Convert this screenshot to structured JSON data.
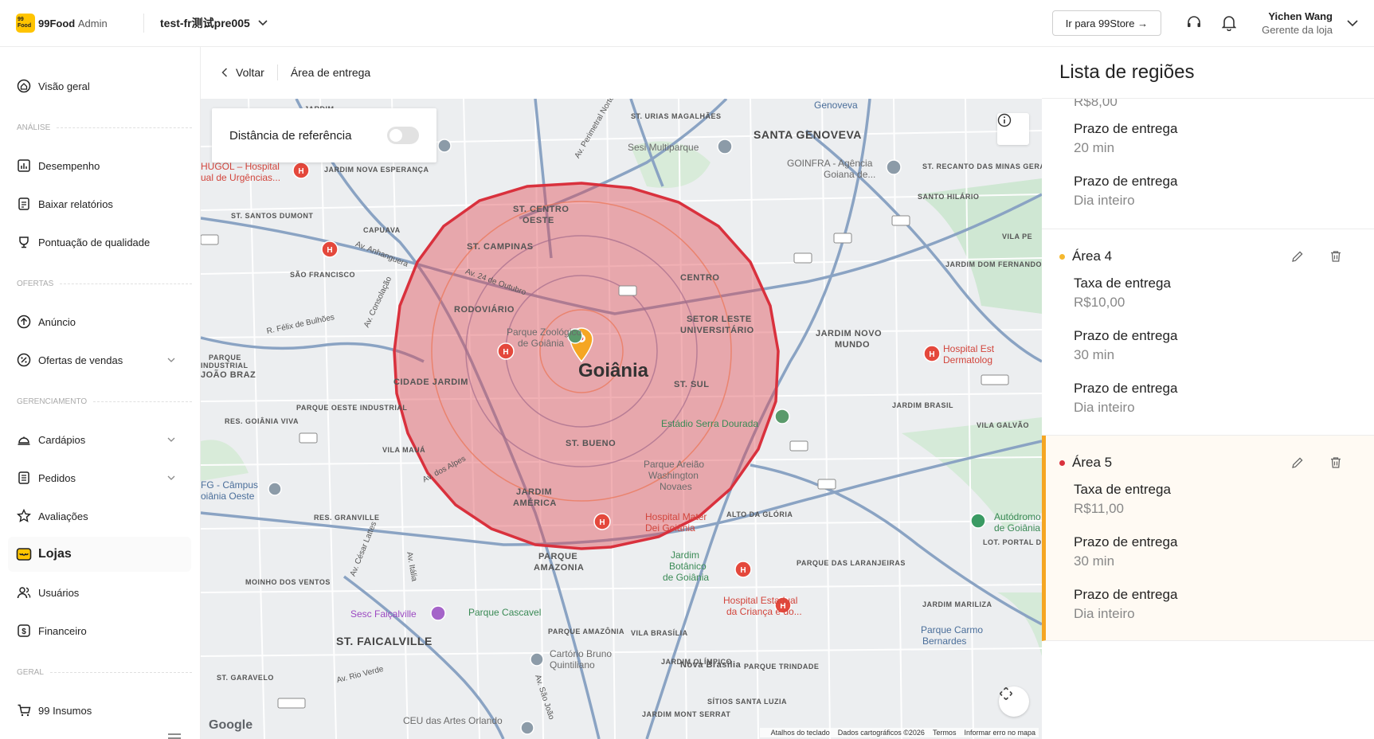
{
  "header": {
    "brand_logo_text": "99 Food",
    "brand_name": "99Food",
    "brand_suffix": "Admin",
    "store_name": "test-fr测试pre005",
    "store_button": "Ir para 99Store →",
    "user_name": "Yichen Wang",
    "user_role": "Gerente da loja"
  },
  "sidebar": {
    "items": [
      {
        "label": "Visão geral",
        "icon": "home-icon"
      },
      {
        "label": "Desempenho",
        "icon": "chart-icon"
      },
      {
        "label": "Baixar relatórios",
        "icon": "report-icon"
      },
      {
        "label": "Pontuação de qualidade",
        "icon": "trophy-icon"
      },
      {
        "label": "Anúncio",
        "icon": "arrow-up-circle-icon"
      },
      {
        "label": "Ofertas de vendas",
        "icon": "discount-icon"
      },
      {
        "label": "Cardápios",
        "icon": "cloche-icon"
      },
      {
        "label": "Pedidos",
        "icon": "orders-icon"
      },
      {
        "label": "Avaliações",
        "icon": "star-icon"
      },
      {
        "label": "Lojas",
        "icon": "store-icon"
      },
      {
        "label": "Usuários",
        "icon": "users-icon"
      },
      {
        "label": "Financeiro",
        "icon": "dollar-icon"
      },
      {
        "label": "99 Insumos",
        "icon": "cart-icon"
      }
    ],
    "sections": [
      "ANÁLISE",
      "OFERTAS",
      "GERENCIAMENTO",
      "GERAL"
    ]
  },
  "breadcrumb": {
    "back_label": "Voltar",
    "title": "Área de entrega"
  },
  "map": {
    "reference_label": "Distância de referência",
    "reference_enabled": false,
    "zone_color": "#d9313d",
    "zone_fill": "#e8787f",
    "labels": {
      "city": "Goiânia",
      "genoveva": "Genoveva",
      "santa_genoveva": "SANTA GENOVEVA",
      "st_centro_oeste_1": "ST. CENTRO",
      "st_centro_oeste_2": "OESTE",
      "st_campinas": "ST. CAMPINAS",
      "centro": "CENTRO",
      "rodoviario": "RODOVIÁRIO",
      "setor_leste_1": "SETOR LESTE",
      "setor_leste_2": "UNIVERSITÁRIO",
      "cidade_jardim": "CIDADE JARDIM",
      "st_sul": "ST. SUL",
      "st_bueno": "ST. BUENO",
      "jardim_america_1": "JARDIM",
      "jardim_america_2": "AMÉRICA",
      "parque_amazonia_1": "PARQUE",
      "parque_amazonia_2": "AMAZONIA",
      "jardim_novo_mundo_1": "JARDIM NOVO",
      "jardim_novo_mundo_2": "MUNDO",
      "st_faicalville": "ST. FAICALVILLE",
      "nova_brasilia": "Nova Brasilia",
      "sesi": "Sesi Multiparque",
      "goinfra_1": "GOINFRA - Agência",
      "goinfra_2": "Goiana de...",
      "hugol_1": "HUGOL – Hospital",
      "hugol_2": "ual de Urgências...",
      "zoo_1": "Parque Zoológico",
      "zoo_2": "de Goiânia",
      "serra_dourada": "Estádio Serra Dourada",
      "areiao_1": "Parque Areião",
      "areiao_2": "Washington",
      "areiao_3": "Novaes",
      "mater_1": "Hospital Mater",
      "mater_2": "Dei Goiânia",
      "botanico_1": "Jardim",
      "botanico_2": "Botânico",
      "botanico_3": "de Goiânia",
      "hosp_crianca_1": "Hospital Estadual",
      "hosp_crianca_2": "da Criança e do...",
      "sesc": "Sesc Faiçalville",
      "cascavel": "Parque Cascavel",
      "cartorio_1": "Cartório Bruno",
      "cartorio_2": "Quintiliano",
      "autodromo_1": "Autódromo",
      "autodromo_2": "de Goiânia",
      "carmo_1": "Parque Carmo",
      "carmo_2": "Bernardes",
      "hosp_est_1": "Hospital Est",
      "hosp_est_2": "Dermatolog",
      "ifg_1": "FG - Câmpus",
      "ifg_2": "oiânia Oeste",
      "ceu": "CEU das Artes Orlando",
      "av_anhanguera": "Av. Anhanguera",
      "av_perimetral": "Av. Perimetral Norte",
      "av_consolacao": "Av. Consolação",
      "av_bulhoes": "R. Félix de Bulhões",
      "av_alpes": "Av. dos Alpes",
      "av_rio_verde": "Av. Rio Verde",
      "av_cesar_lattes": "Av. César Lattes",
      "av_italia": "Av. Itália",
      "av_sao_joao": "Av. São João",
      "av_24_outubro": "Av. 24 de Outubro",
      "jardim_nova_esperanca": "JARDIM NOVA ESPERANÇA",
      "capuava": "CAPUAVA",
      "sao_francisco": "SÃO FRANCISCO",
      "st_santos_dumont": "ST. SANTOS DUMONT",
      "parque_ind_joao_braz_1": "PARQUE",
      "parque_ind_joao_braz_2": "INDUSTRIAL",
      "parque_ind_joao_braz_3": "JOÃO BRAZ",
      "res_goiania_viva": "RES. GOIÂNIA VIVA",
      "vila_mauá": "VILA MAUÁ",
      "res_granville": "RES. GRANVILLE",
      "moinho_ventos": "MOINHO DOS VENTOS",
      "st_garavelo": "ST. GARAVELO",
      "jardim_mont_serrat": "JARDIM MONT SERRAT",
      "vila_brasilia": "VILA BRASÍLIA",
      "parque_amazonia_s": "PARQUE AMAZÔNIA",
      "jardim_olimpico": "JARDIM OLÍMPICO",
      "parque_trindade": "PARQUE TRINDADE",
      "parque_laranjeiras": "PARQUE DAS LARANJEIRAS",
      "jardim_marilizia": "JARDIM MARILIZA",
      "vila_galvao": "VILA GALVÃO",
      "jardim_brasil": "JARDIM BRASIL",
      "lot_portal": "LOT. PORTAL DO SOL II",
      "jardim_dom_fernando": "JARDIM DOM FERNANDO I",
      "santo_hilario": "SANTO HILÁRIO",
      "st_recanto": "ST. RECANTO DAS MINAS GERAIS",
      "st_urias": "ST. URIAS MAGALHÃES",
      "parque_oeste_industrial": "PARQUE OESTE INDUSTRIAL",
      "sitios_santa": "SÍTIOS SANTA LUZIA",
      "jardim_label_top": "JARDIM",
      "vila_pe": "VILA PE",
      "alto_gloria": "ALTO DA GLÓRIA"
    },
    "footer": {
      "google": "Google",
      "shortcuts": "Atalhos do teclado",
      "data": "Dados cartográficos ©2026",
      "terms": "Termos",
      "report": "Informar erro no mapa"
    }
  },
  "panel": {
    "title": "Lista de regiões",
    "top_partial": {
      "value_cut": "R$8,00",
      "fields": [
        {
          "label": "Prazo de entrega",
          "value": "20 min"
        },
        {
          "label": "Prazo de entrega",
          "value": "Dia inteiro"
        }
      ]
    },
    "areas": [
      {
        "name": "Área 4",
        "dot_color": "#f5b82e",
        "fields": [
          {
            "label": "Taxa de entrega",
            "value": "R$10,00"
          },
          {
            "label": "Prazo de entrega",
            "value": "30 min"
          },
          {
            "label": "Prazo de entrega",
            "value": "Dia inteiro"
          }
        ]
      },
      {
        "name": "Área 5",
        "dot_color": "#d9313d",
        "fields": [
          {
            "label": "Taxa de entrega",
            "value": "R$11,00"
          },
          {
            "label": "Prazo de entrega",
            "value": "30 min"
          },
          {
            "label": "Prazo de entrega",
            "value": "Dia inteiro"
          }
        ]
      }
    ]
  }
}
